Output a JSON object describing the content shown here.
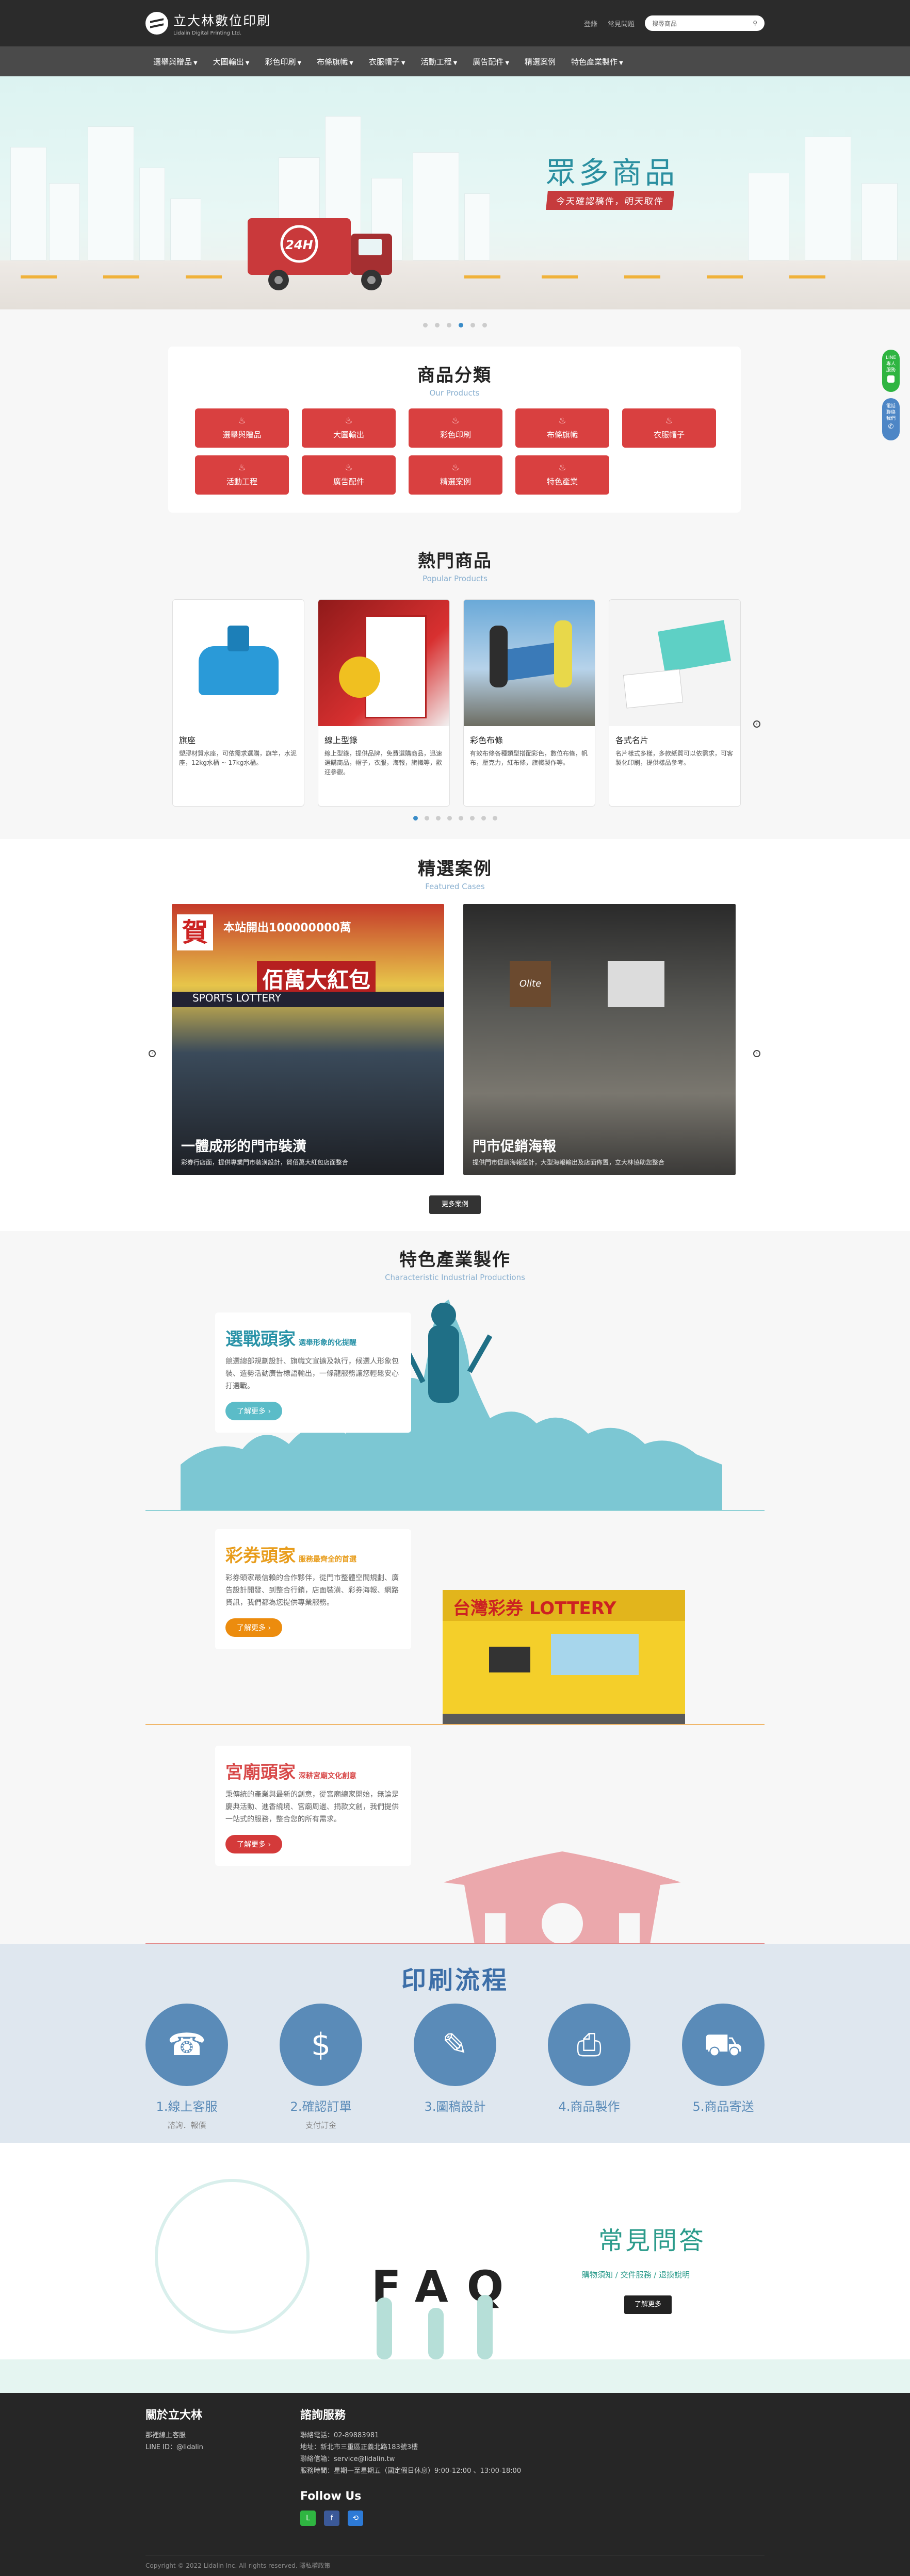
{
  "header": {
    "logo_title": "立大林數位印刷",
    "logo_sub": "Lidalin Digital Printing Ltd.",
    "links": [
      "登錄",
      "常見問題"
    ],
    "search_placeholder": "搜尋商品"
  },
  "nav": [
    "選舉與贈品",
    "大圖輸出",
    "彩色印刷",
    "布條旗幟",
    "衣服帽子",
    "活動工程",
    "廣告配件",
    "精選案例",
    "特色產業製作"
  ],
  "hero": {
    "title": "眾多商品",
    "subtitle": "今天確認稿件，明天取件",
    "truck_label": "24H"
  },
  "float": {
    "line": "LINE\n專人\n服務",
    "call": "電話\n聯絡\n我們"
  },
  "category": {
    "title": "商品分類",
    "sub": "Our Products",
    "items": [
      "選舉與贈品",
      "大圖輸出",
      "彩色印刷",
      "布條旗幟",
      "衣服帽子",
      "活動工程",
      "廣告配件",
      "精選案例",
      "特色產業"
    ]
  },
  "popular": {
    "title": "熱門商品",
    "sub": "Popular Products",
    "items": [
      {
        "name": "旗座",
        "desc": "塑膠材質水座，可依需求選購，旗竿，水泥座，12kg水桶 ~ 17kg水桶。"
      },
      {
        "name": "線上型錄",
        "desc": "線上型錄，提供品牌，免費選購商品，迅速選購商品，帽子，衣服，海報，旗幟等，歡迎參觀。"
      },
      {
        "name": "彩色布條",
        "desc": "有效布條各種類型搭配彩色，數位布條，帆布，壓克力，紅布條，旗幟製作等。"
      },
      {
        "name": "各式名片",
        "desc": "名片樣式多樣，多款紙質可以依需求，可客製化印刷，提供樣品參考。"
      }
    ]
  },
  "cases": {
    "title": "精選案例",
    "sub": "Featured Cases",
    "items": [
      {
        "title": "一體成形的門市裝潢",
        "desc": "彩券行店面，提供專業門市裝潢設計，賀佰萬大紅包店面整合"
      },
      {
        "title": "門市促銷海報",
        "desc": "提供門市促銷海報設計，大型海報輸出及店面佈置，立大林協助您整合"
      }
    ],
    "more": "更多案例",
    "sign_a": "賀",
    "sign_b": "佰萬大紅包",
    "sign_c": "本站開出100000000萬",
    "sign_d": "SPORTS LOTTERY",
    "logo_text": "Olite"
  },
  "industry": {
    "title": "特色產業製作",
    "sub": "Characteristic Industrial Productions",
    "items": [
      {
        "title": "選戰頭家",
        "tag": "選舉形象的化提醒",
        "desc": "競選總部規劃設計、旗幟文宣擴及執行，候選人形象包裝、造勢活動廣告標語輸出，一條龍服務讓您輕鬆安心打選戰。",
        "more": "了解更多 ›",
        "color": "#2a93a8"
      },
      {
        "title": "彩券頭家",
        "tag": "服務最齊全的首選",
        "desc": "彩券頭家最信賴的合作夥伴，從門市整體空間規劃、廣告設計開發、到整合行銷，店面裝潢、彩券海報、網路資訊，我們都為您提供專業服務。",
        "more": "了解更多 ›",
        "color": "#e89c1a",
        "lottery": "台灣彩券 LOTTERY"
      },
      {
        "title": "宮廟頭家",
        "tag": "深耕宮廟文化創意",
        "desc": "秉傳統的產業與最新的創意，從宮廟總家開始，無論是慶典活動、進香繞境、宮廟周邊、捐款文創，我們提供一站式的服務，整合您的所有需求。",
        "more": "了解更多 ›",
        "color": "#d84a4a"
      }
    ]
  },
  "process": {
    "title": "印刷流程",
    "steps": [
      {
        "name": "1.線上客服",
        "sub": "諮詢．報價",
        "icon": "headset-icon"
      },
      {
        "name": "2.確認訂單",
        "sub": "支付訂金",
        "icon": "payment-icon"
      },
      {
        "name": "3.圖稿設計",
        "sub": "",
        "icon": "design-icon"
      },
      {
        "name": "4.商品製作",
        "sub": "",
        "icon": "printer-icon"
      },
      {
        "name": "5.商品寄送",
        "sub": "",
        "icon": "delivery-icon"
      }
    ]
  },
  "faq": {
    "title": "常見問答",
    "links": "購物須知 / 交件服務 / 退換說明",
    "more": "了解更多",
    "word": "FAQ"
  },
  "footer": {
    "about_title": "關於立大林",
    "about": [
      "那裡線上客服",
      "LINE ID：@lidalin"
    ],
    "service_title": "諮詢服務",
    "service": [
      "聯絡電話：02-89883981",
      "地址：新北市三重區正義北路183號3樓",
      "聯絡信箱：service@lidalin.tw",
      "服務時間：星期一至星期五（國定假日休息）9:00-12:00 、13:00-18:00"
    ],
    "follow": "Follow Us",
    "copy": "Copyright © 2022 Lidalin Inc. All rights reserved.    隱私權政策"
  }
}
